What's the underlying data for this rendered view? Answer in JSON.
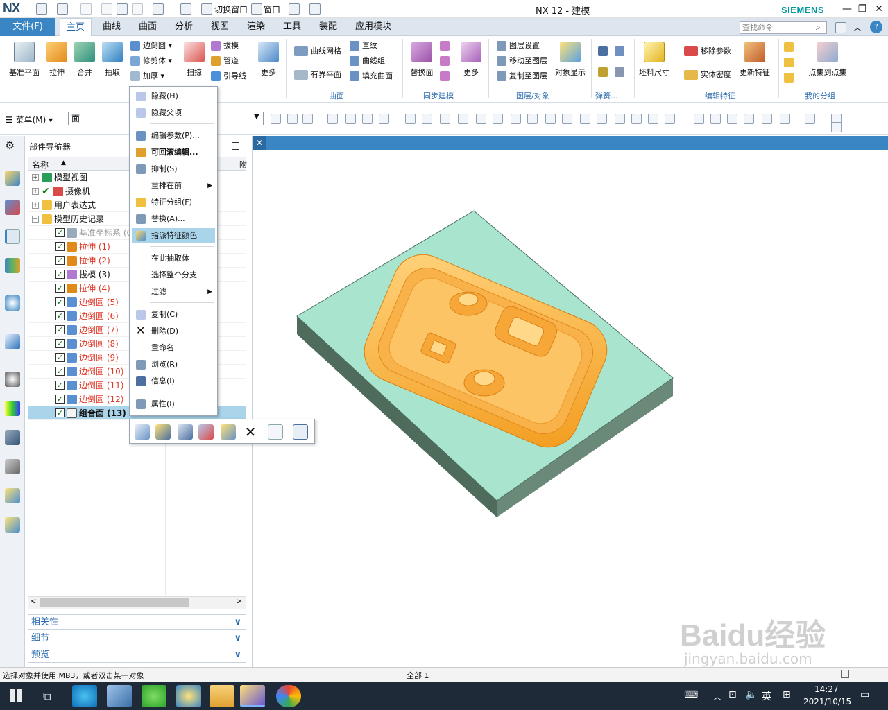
{
  "app": {
    "logo": "NX",
    "title": "NX 12 - 建模",
    "brand": "SIEMENS"
  },
  "quickaccess": {
    "switch_window": "切换窗口",
    "window": "窗口"
  },
  "window_controls": {
    "minimize": "—",
    "restore": "❐",
    "close": "✕"
  },
  "tabs": {
    "file": "文件(F)",
    "items": [
      "主页",
      "曲线",
      "曲面",
      "分析",
      "视图",
      "渲染",
      "工具",
      "装配",
      "应用模块"
    ]
  },
  "search": {
    "placeholder": "查找命令"
  },
  "ribbon": {
    "datum_plane": "基准平面",
    "extrude": "拉伸",
    "unite": "合并",
    "extract": "抽取",
    "edge_blend": "边倒圆",
    "trim_body": "修剪体",
    "thicken": "加厚",
    "sweep": "扫掠",
    "draft": "拔模",
    "tube": "管道",
    "guide_line": "引导线",
    "more1": "更多",
    "curve_mesh": "曲线网格",
    "bounded_plane": "有界平面",
    "ruled": "直纹",
    "curve_group": "曲线组",
    "fill_surface": "填充曲面",
    "replace_face": "替换面",
    "more2": "更多",
    "layer_settings": "图层设置",
    "move_to_layer": "移动至图层",
    "copy_to_layer": "复制至图层",
    "object_display": "对象显示",
    "stock_size": "坯料尺寸",
    "remove_params": "移除参数",
    "solid_density": "实体密度",
    "update_feature": "更新特征",
    "point_to_point": "点集到点集",
    "groups": {
      "surface": "曲面",
      "sync_modeling": "同步建模",
      "layer_object": "图层/对象",
      "spring": "弹簧...",
      "edit_feature": "编辑特征",
      "my_group": "我的分组"
    }
  },
  "toolbar2": {
    "menu": "菜单(M)",
    "filter_value": "面"
  },
  "navigator": {
    "title": "部件导航器",
    "col_name": "名称",
    "col_extra": "附",
    "rows": [
      {
        "label": "模型视图",
        "type": "node"
      },
      {
        "label": "摄像机",
        "type": "node"
      },
      {
        "label": "用户表达式",
        "type": "node"
      },
      {
        "label": "模型历史记录",
        "type": "node"
      },
      {
        "label": "基准坐标系 (0)",
        "type": "datum"
      },
      {
        "label": "拉伸 (1)",
        "type": "red"
      },
      {
        "label": "拉伸 (2)",
        "type": "red"
      },
      {
        "label": "拔模 (3)",
        "type": "normal"
      },
      {
        "label": "拉伸 (4)",
        "type": "red"
      },
      {
        "label": "边倒圆 (5)",
        "type": "red"
      },
      {
        "label": "边倒圆 (6)",
        "type": "red"
      },
      {
        "label": "边倒圆 (7)",
        "type": "red"
      },
      {
        "label": "边倒圆 (8)",
        "type": "red"
      },
      {
        "label": "边倒圆 (9)",
        "type": "red"
      },
      {
        "label": "边倒圆 (10)",
        "type": "red"
      },
      {
        "label": "边倒圆 (11)",
        "type": "red"
      },
      {
        "label": "边倒圆 (12)",
        "type": "red"
      },
      {
        "label": "组合面 (13)",
        "type": "selected"
      }
    ],
    "panels": [
      "相关性",
      "细节",
      "预览"
    ]
  },
  "context_menu": {
    "hide": "隐藏(H)",
    "hide_parents": "隐藏父项",
    "edit_params": "编辑参数(P)...",
    "rollback_edit": "可回滚编辑...",
    "suppress": "抑制(S)",
    "reorder_before": "重排在前",
    "feature_group": "特征分组(F)",
    "replace": "替换(A)...",
    "assign_color": "指派特征颜色",
    "extract_here": "在此抽取体",
    "select_branch": "选择整个分支",
    "filter": "过滤",
    "copy": "复制(C)",
    "delete": "删除(D)",
    "rename": "重命名",
    "browse": "浏览(R)",
    "info": "信息(I)",
    "properties": "属性(I)"
  },
  "status": {
    "left": "选择对象并使用 MB3，或者双击某一对象",
    "mid": "全部 1"
  },
  "watermark": {
    "text": "Baidu经验",
    "url": "jingyan.baidu.com"
  },
  "taskbar": {
    "ime": "英",
    "time": "14:27",
    "date": "2021/10/15"
  },
  "colors": {
    "accent": "#3a86c4",
    "block_top": "#a9e4cf",
    "block_side_dark": "#4f6b5c",
    "block_side_mid": "#6a8978",
    "cavity": "#f8b440",
    "selected_row": "#a9d4ea"
  }
}
